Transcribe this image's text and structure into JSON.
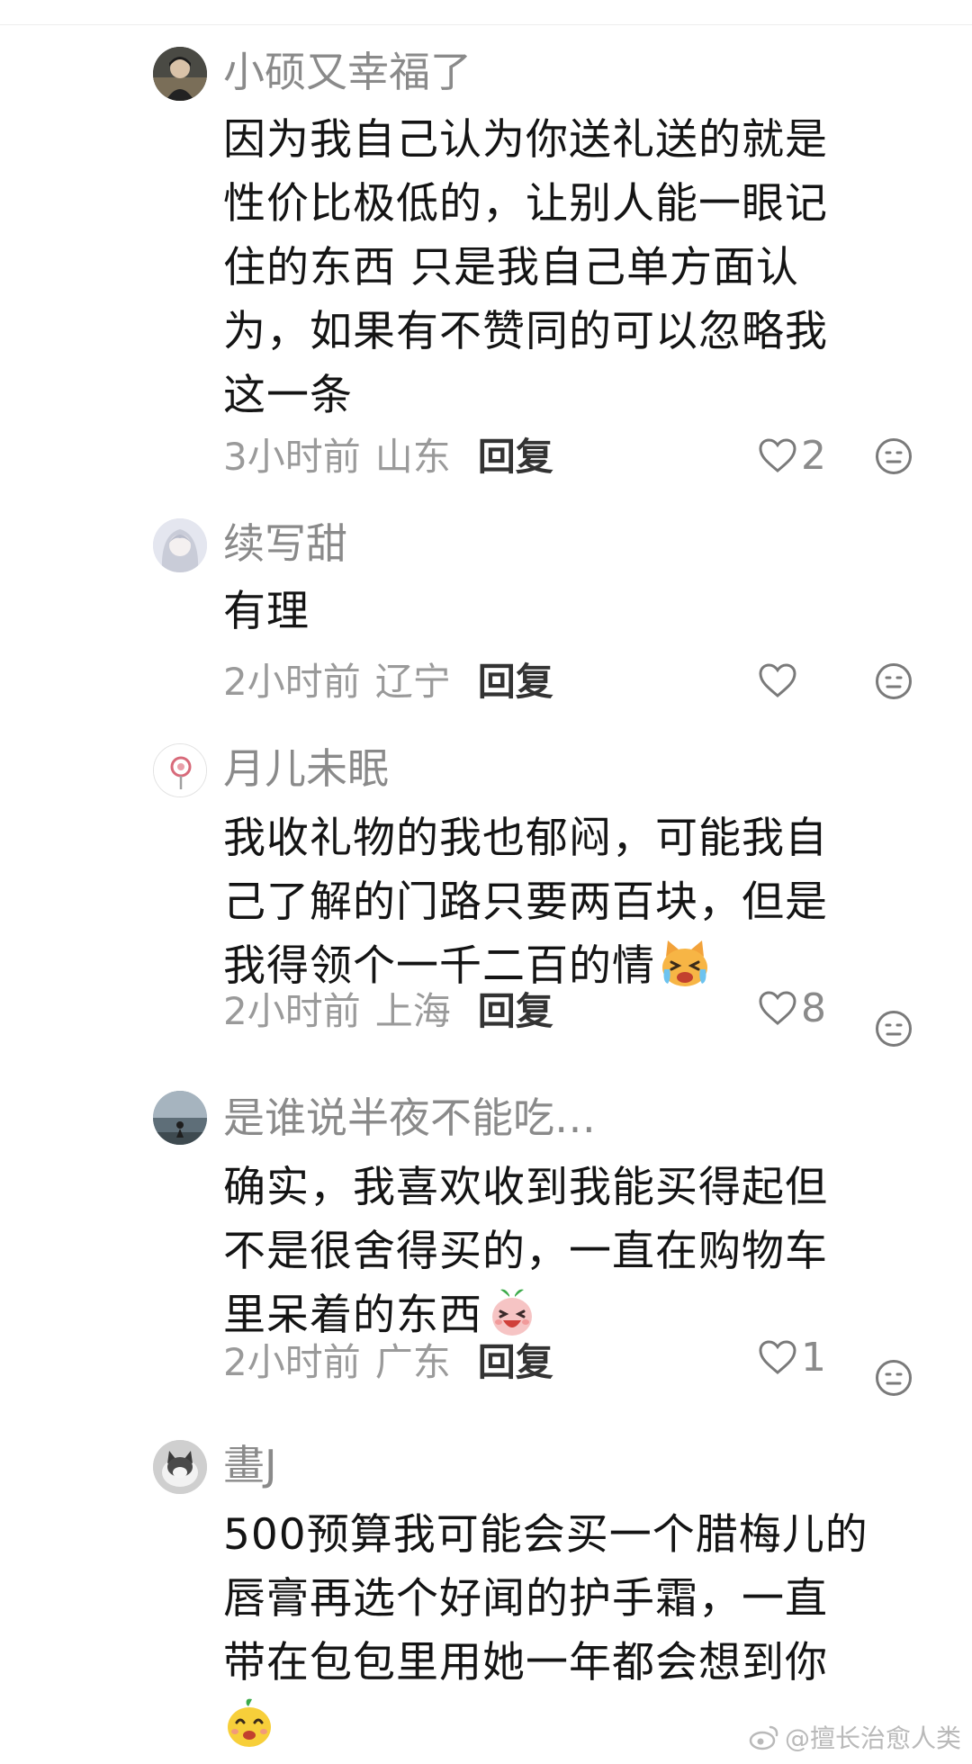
{
  "comments": [
    {
      "username": "小硕又幸福了",
      "avatar_icon": "user-photo-avatar",
      "content_lines": [
        "因为我自己认为你送礼送的就是",
        "性价比极低的，让别人能一眼记",
        "住的东西 只是我自己单方面认",
        "为，如果有不赞同的可以忽略我",
        "这一条"
      ],
      "time": "3小时前",
      "location": "山东",
      "reply_label": "回复",
      "likes": "2"
    },
    {
      "username": "续写甜",
      "avatar_icon": "anime-girl-avatar",
      "content_lines": [
        "有理"
      ],
      "time": "2小时前",
      "location": "辽宁",
      "reply_label": "回复",
      "likes": ""
    },
    {
      "username": "月儿未眠",
      "avatar_icon": "lollipop-avatar",
      "content_lines": [
        "我收礼物的我也郁闷，可能我自",
        "己了解的门路只要两百块，但是",
        "我得领个一千二百的情"
      ],
      "content_emoji": "crying-cat-emoji",
      "time": "2小时前",
      "location": "上海",
      "reply_label": "回复",
      "likes": "8"
    },
    {
      "username": "是谁说半夜不能吃…",
      "avatar_icon": "seaside-photo-avatar",
      "content_lines": [
        "确实，我喜欢收到我能买得起但",
        "不是很舍得买的，一直在购物车",
        "里呆着的东西"
      ],
      "content_emoji": "laughing-radish-emoji",
      "time": "2小时前",
      "location": "广东",
      "reply_label": "回复",
      "likes": "1"
    },
    {
      "username": "畫J",
      "avatar_icon": "cat-photo-avatar",
      "content_lines": [
        "500预算我可能会买一个腊梅儿的",
        "唇膏再选个好闻的护手霜，一直",
        "带在包包里用她一年都会想到你"
      ],
      "content_emoji": "happy-mango-emoji"
    }
  ],
  "watermark": "@擅长治愈人类",
  "colors": {
    "username": "#8a8a8a",
    "meta": "#9a9a9a",
    "reply": "#333333",
    "text": "#141414"
  }
}
